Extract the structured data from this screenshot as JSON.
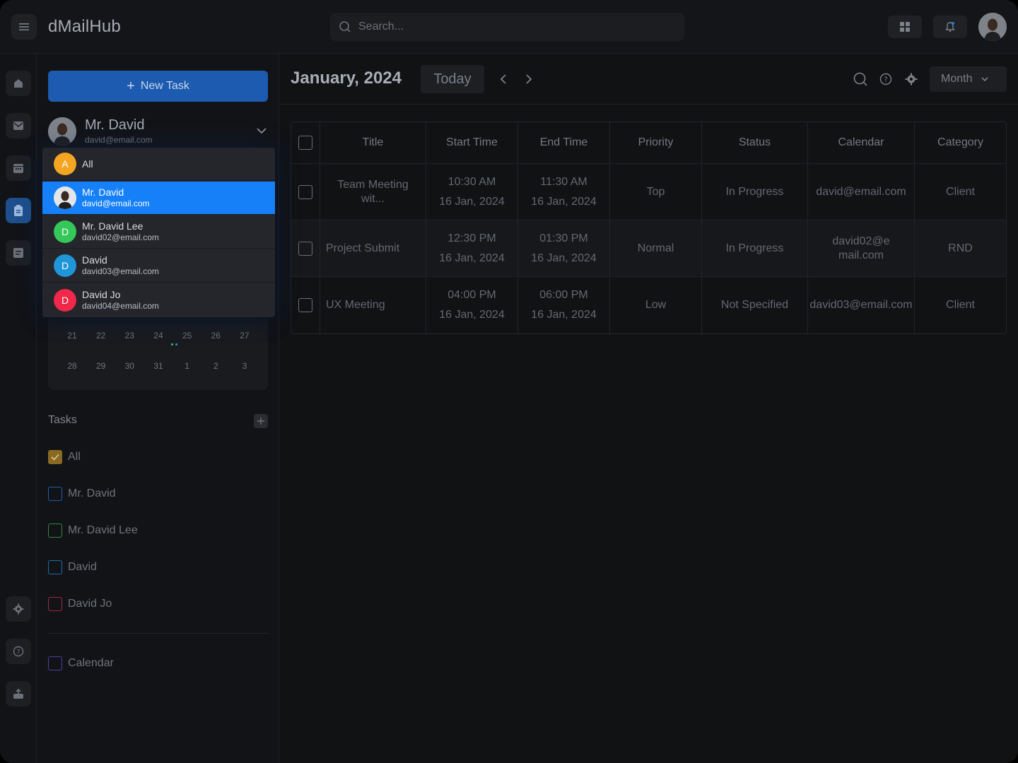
{
  "app": {
    "title": "dMailHub"
  },
  "search": {
    "placeholder": "Search..."
  },
  "sidebar": {
    "new_task_label": "New Task",
    "current_user": {
      "name": "Mr. David",
      "email": "david@email.com"
    },
    "mini_calendar": {
      "weeks": [
        [
          "21",
          "22",
          "23",
          "24",
          "25",
          "26",
          "27"
        ],
        [
          "28",
          "29",
          "30",
          "31",
          "1",
          "2",
          "3"
        ]
      ]
    },
    "tasks_title": "Tasks",
    "filters": [
      {
        "label": "All",
        "checked": true,
        "color": "#b8861e"
      },
      {
        "label": "Mr. David",
        "checked": false,
        "color": "#1e5fb0"
      },
      {
        "label": "Mr. David Lee",
        "checked": false,
        "color": "#2f8a3a"
      },
      {
        "label": "David",
        "checked": false,
        "color": "#1e6fa8"
      },
      {
        "label": "David Jo",
        "checked": false,
        "color": "#a0283c"
      }
    ],
    "calendar_filter": {
      "label": "Calendar",
      "checked": false,
      "color": "#4a3fa0"
    }
  },
  "dropdown": {
    "items": [
      {
        "initial": "A",
        "name": "All",
        "email": "",
        "color": "#f4a623",
        "selected": false
      },
      {
        "initial": "",
        "name": "Mr. David",
        "email": "david@email.com",
        "color": "#dcdfe3",
        "selected": true
      },
      {
        "initial": "D",
        "name": "Mr. David Lee",
        "email": "david02@email.com",
        "color": "#35c759",
        "selected": false
      },
      {
        "initial": "D",
        "name": "David",
        "email": "david03@email.com",
        "color": "#1e96d8",
        "selected": false
      },
      {
        "initial": "D",
        "name": "David Jo",
        "email": "david04@email.com",
        "color": "#f0284a",
        "selected": false
      }
    ]
  },
  "main": {
    "month_title": "January, 2024",
    "today_label": "Today",
    "view_label": "Month",
    "table": {
      "headers": [
        "Title",
        "Start Time",
        "End Time",
        "Priority",
        "Status",
        "Calendar",
        "Category"
      ],
      "rows": [
        {
          "title": "Team Meeting wit...",
          "start_time": "10:30 AM",
          "start_date": "16 Jan, 2024",
          "end_time": "11:30 AM",
          "end_date": "16 Jan, 2024",
          "priority": "Top",
          "status": "In Progress",
          "calendar": "david@email.com",
          "category": "Client"
        },
        {
          "title": "Project Submit",
          "start_time": "12:30 PM",
          "start_date": "16 Jan, 2024",
          "end_time": "01:30 PM",
          "end_date": "16 Jan, 2024",
          "priority": "Normal",
          "status": "In Progress",
          "calendar": "david02@email.com",
          "category": "RND"
        },
        {
          "title": "UX Meeting",
          "start_time": "04:00 PM",
          "start_date": "16 Jan, 2024",
          "end_time": "06:00 PM",
          "end_date": "16 Jan, 2024",
          "priority": "Low",
          "status": "Not Specified",
          "calendar": "david03@email.com",
          "category": "Client"
        }
      ]
    }
  }
}
